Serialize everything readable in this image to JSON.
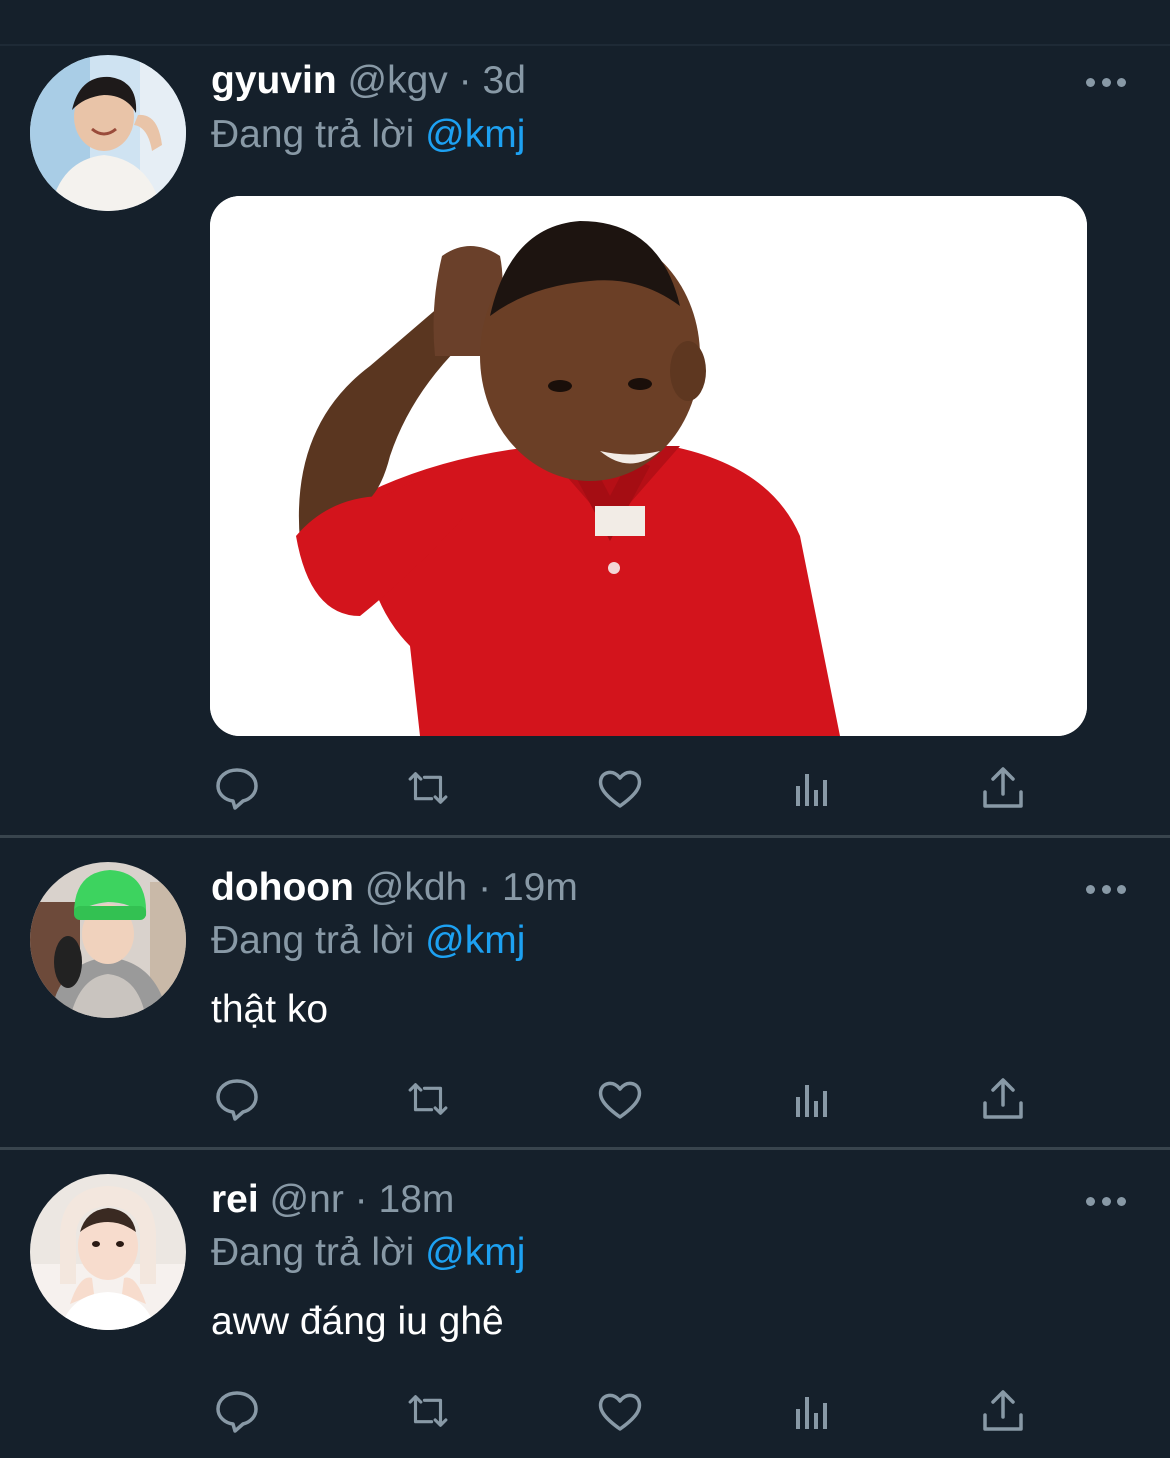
{
  "reply_prefix": "Đang trả lời",
  "colors": {
    "background": "#15202b",
    "secondary_text": "#8899a6",
    "link": "#1da1f2",
    "divider": "#38444d"
  },
  "tweets": [
    {
      "name": "gyuvin",
      "handle": "@kgv",
      "separator": "·",
      "time": "3d",
      "reply_to": "@kmj",
      "text": "",
      "has_media": true,
      "media_icon": "photo-boy-red-polo-scratching-head"
    },
    {
      "name": "dohoon",
      "handle": "@kdh",
      "separator": "·",
      "time": "19m",
      "reply_to": "@kmj",
      "text": "thật ko",
      "has_media": false
    },
    {
      "name": "rei",
      "handle": "@nr",
      "separator": "·",
      "time": "18m",
      "reply_to": "@kmj",
      "text": "aww đáng iu ghê",
      "has_media": false
    }
  ],
  "action_icons": [
    "reply-icon",
    "retweet-icon",
    "like-icon",
    "analytics-icon",
    "share-icon"
  ]
}
